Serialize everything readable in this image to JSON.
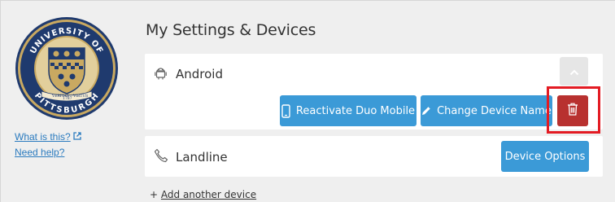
{
  "sidebar": {
    "logo": {
      "top_text": "UNIVERSITY OF",
      "bottom_text": "PITTSBURGH",
      "banner_left": "VERITAS",
      "banner_right": "VIRTUS",
      "year": "1787"
    },
    "what_is_this": "What is this?",
    "need_help": "Need help?"
  },
  "main": {
    "title": "My Settings & Devices",
    "devices": [
      {
        "name": "Android",
        "icon": "android-icon",
        "reactivate_label": "Reactivate Duo Mobile",
        "rename_label": "Change Device Name",
        "delete_icon": "trash-icon"
      },
      {
        "name": "Landline",
        "icon": "phone-icon",
        "options_label": "Device Options"
      }
    ],
    "add_prefix": "+",
    "add_device": "Add another device"
  },
  "colors": {
    "primary": "#3b9ad7",
    "danger": "#b8312f",
    "highlight": "#e31b23",
    "link": "#2b7bbf"
  }
}
